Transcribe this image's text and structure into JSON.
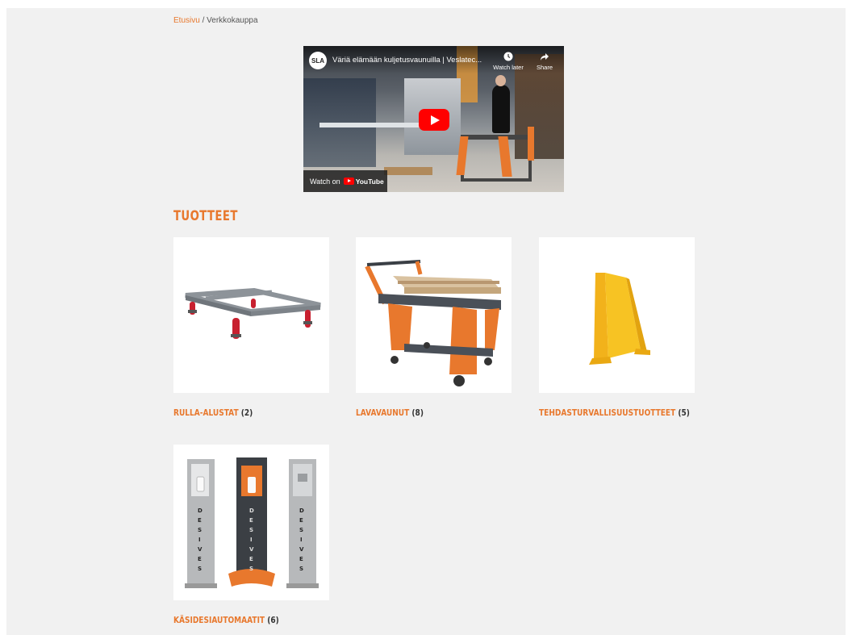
{
  "breadcrumb": {
    "home": "Etusivu",
    "separator": " / ",
    "current": "Verkkokauppa"
  },
  "video": {
    "channel_logo": "SLA",
    "title": "Väriä elämään kuljetusvaunuilla | Veslatec...",
    "watch_later": "Watch later",
    "share": "Share",
    "watch_on": "Watch on",
    "youtube": "YouTube"
  },
  "section_title": "TUOTTEET",
  "products": [
    {
      "name": "RULLA-ALUSTAT",
      "count": "(2)",
      "icon": "roller-base-image"
    },
    {
      "name": "LAVAVAUNUT",
      "count": "(8)",
      "icon": "pallet-trolley-image"
    },
    {
      "name": "TEHDASTURVALLISUUSTUOTTEET",
      "count": "(5)",
      "icon": "safety-barrier-image"
    },
    {
      "name": "KÄSIDESIAUTOMAATIT",
      "count": "(6)",
      "icon": "hand-sanitizer-stations-image"
    }
  ],
  "colors": {
    "accent": "#e8782d",
    "background": "#f1f1f1",
    "text": "#333333"
  }
}
